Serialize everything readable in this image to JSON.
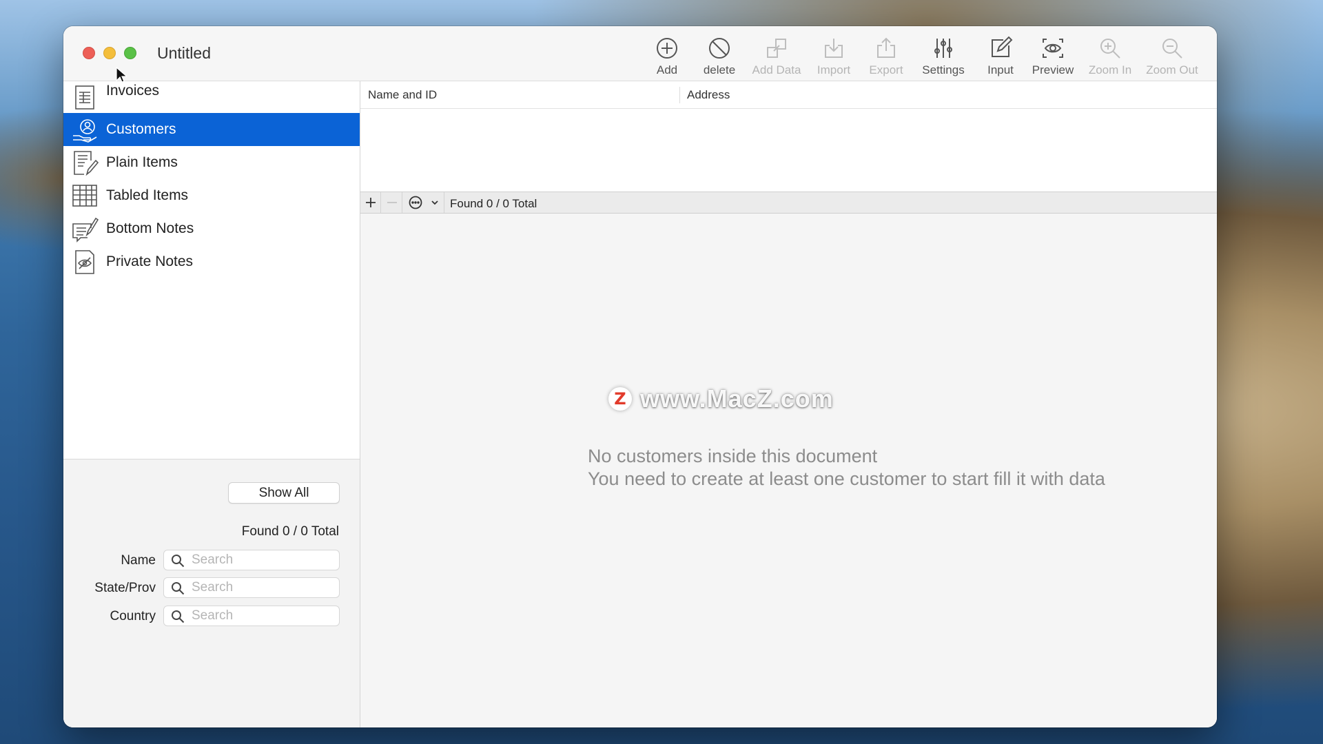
{
  "window": {
    "title": "Untitled"
  },
  "toolbar": {
    "items": [
      {
        "label": "Add",
        "icon": "plus-circle-icon",
        "enabled": true
      },
      {
        "label": "delete",
        "icon": "prohibit-icon",
        "enabled": true
      },
      {
        "label": "Add Data",
        "icon": "add-data-icon",
        "enabled": false
      },
      {
        "label": "Import",
        "icon": "import-icon",
        "enabled": false
      },
      {
        "label": "Export",
        "icon": "export-icon",
        "enabled": false
      },
      {
        "label": "Settings",
        "icon": "sliders-icon",
        "enabled": true
      },
      {
        "label": "Input",
        "icon": "pencil-icon",
        "enabled": true
      },
      {
        "label": "Preview",
        "icon": "eye-icon",
        "enabled": true
      },
      {
        "label": "Zoom In",
        "icon": "zoom-in-icon",
        "enabled": false
      },
      {
        "label": "Zoom Out",
        "icon": "zoom-out-icon",
        "enabled": false
      }
    ]
  },
  "sidebar": {
    "items": [
      {
        "label": "Invoices",
        "icon": "invoice-icon",
        "selected": false
      },
      {
        "label": "Customers",
        "icon": "customer-icon",
        "selected": true
      },
      {
        "label": "Plain Items",
        "icon": "plain-items-icon",
        "selected": false
      },
      {
        "label": "Tabled Items",
        "icon": "table-grid-icon",
        "selected": false
      },
      {
        "label": "Bottom Notes",
        "icon": "bottom-notes-icon",
        "selected": false
      },
      {
        "label": "Private Notes",
        "icon": "private-notes-icon",
        "selected": false
      }
    ],
    "show_all_label": "Show All",
    "found_text": "Found 0 / 0 Total",
    "filters": [
      {
        "label": "Name",
        "placeholder": "Search",
        "value": ""
      },
      {
        "label": "State/Prov",
        "placeholder": "Search",
        "value": ""
      },
      {
        "label": "Country",
        "placeholder": "Search",
        "value": ""
      }
    ]
  },
  "table": {
    "columns": [
      "Name and ID",
      "Address"
    ],
    "rows": [],
    "found_text": "Found 0 / 0 Total"
  },
  "empty_state": {
    "line1": "No customers inside this document",
    "line2": "You need to create at least one customer to start fill it with data"
  },
  "watermark": {
    "logo": "Z",
    "text": "www.MacZ.com"
  },
  "colors": {
    "selection": "#0b63d6",
    "close": "#ed5f57",
    "minimize": "#f4be3b",
    "maximize": "#5ac147"
  }
}
